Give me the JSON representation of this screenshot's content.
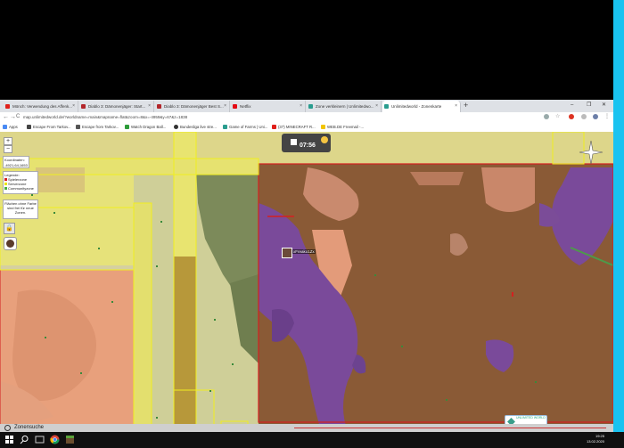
{
  "browser": {
    "tabs": [
      {
        "label": "Mönch: Verwendung des Affenk...",
        "color": "#e0201b"
      },
      {
        "label": "Diablo 3: Dämonenjäger: Start...",
        "color": "#b3262b"
      },
      {
        "label": "Diablo 3: Dämonenjäger Best S...",
        "color": "#b3262b"
      },
      {
        "label": "Netflix",
        "color": "#e50914"
      },
      {
        "label": "Zone verkleinern | Unlimitedwo...",
        "color": "#2a9d8f"
      },
      {
        "label": "Unlimitedworld - Zonenkarte",
        "color": "#2a9d8f"
      }
    ],
    "new_tab": "+",
    "window_controls": {
      "minimize": "–",
      "maximize": "❐",
      "close": "✕"
    },
    "nav": {
      "back": "←",
      "forward": "→",
      "reload": "C",
      "lock": "ⓘ"
    },
    "url": "map.unlimitedworld.de/?worldname=main&mapname=flat&zoom=8&x=-4959&y=67&z=1838",
    "bookmarks": [
      {
        "label": "Apps",
        "color": "#4a8af4"
      },
      {
        "label": "Escape From Tarkov...",
        "color": "#444444"
      },
      {
        "label": "Escape from Tarkov...",
        "color": "#555555"
      },
      {
        "label": "Watch Dragon Ball...",
        "color": "#2e9c3a"
      },
      {
        "label": "Bundesliga live stre...",
        "color": "#333333"
      },
      {
        "label": "Game of Farms | Uni...",
        "color": "#2a9d8f"
      },
      {
        "label": "(37) MINECRAFT R...",
        "color": "#e0201b"
      },
      {
        "label": "WEB.DE Freemail -...",
        "color": "#f2c500"
      }
    ]
  },
  "map": {
    "coords_title": "Koordinaten:",
    "coords_value": "-4921,64,1653",
    "legend_title": "Legende:",
    "legend_items": [
      {
        "label": "Spielerzone",
        "color": "#d42020"
      },
      {
        "label": "Serverzone",
        "color": "#e8e600"
      },
      {
        "label": "Communityzone",
        "color": "#4ab040"
      }
    ],
    "note": "Flächen ohne Farbe sind frei für neue Zonen.",
    "zoom_in": "+",
    "zoom_out": "−",
    "timer": "07:56",
    "player_name": "xFreako1Zx",
    "logo_text": "UNLIMITED WORLD",
    "search_label": "Zonensuche",
    "colors": {
      "brown_terrain": "#8a5a36",
      "yellow_zone": "#e6e27a",
      "salmon_terrain": "#e8a07c",
      "purple_water": "#7a4a9a",
      "red_border": "#d42020",
      "yellow_border": "#f0ee20"
    }
  },
  "taskbar": {
    "time": "19:25",
    "date": "13.02.2020"
  }
}
